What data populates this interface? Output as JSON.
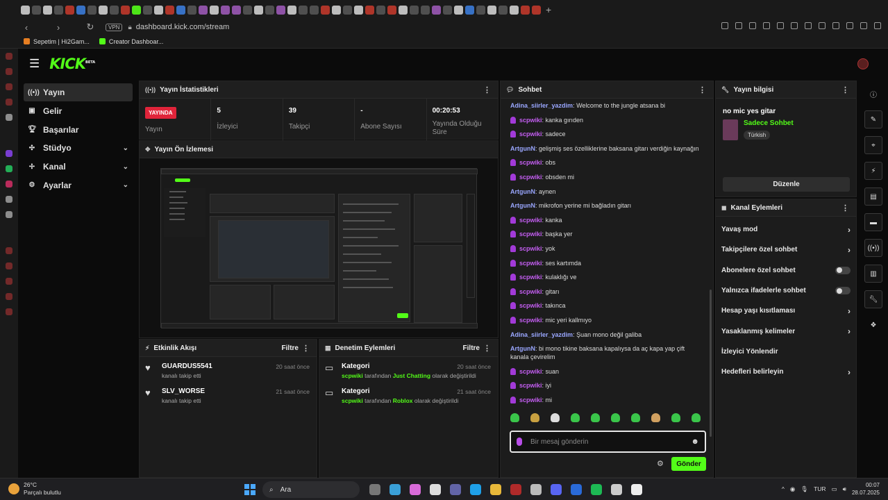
{
  "browser": {
    "url": "dashboard.kick.com/stream",
    "vpn_label": "VPN",
    "bookmarks": [
      "Sepetim | Hi2Gam...",
      "Creator Dashboar..."
    ]
  },
  "app": {
    "logo": "KICK",
    "logo_badge": "BETA",
    "nav": [
      {
        "label": "Yayın",
        "icon": "broadcast-icon",
        "active": true
      },
      {
        "label": "Gelir",
        "icon": "revenue-icon"
      },
      {
        "label": "Başarılar",
        "icon": "trophy-icon"
      },
      {
        "label": "Stüdyo",
        "icon": "studio-icon",
        "expandable": true
      },
      {
        "label": "Kanal",
        "icon": "channel-icon",
        "expandable": true
      },
      {
        "label": "Ayarlar",
        "icon": "gear-icon",
        "expandable": true
      }
    ]
  },
  "stats": {
    "title": "Yayın İstatistikleri",
    "live_badge": "YAYINDA",
    "items": [
      {
        "label": "Yayın"
      },
      {
        "value": "5",
        "label": "İzleyici"
      },
      {
        "value": "39",
        "label": "Takipçi"
      },
      {
        "value": "-",
        "label": "Abone Sayısı"
      },
      {
        "value": "00:20:53",
        "label": "Yayında Olduğu Süre"
      }
    ]
  },
  "preview": {
    "title": "Yayın Ön İzlemesi"
  },
  "activity": {
    "title": "Etkinlik Akışı",
    "filter": "Filtre",
    "items": [
      {
        "name": "GUARDUS5541",
        "sub": "kanalı takip etti",
        "time": "20 saat önce"
      },
      {
        "name": "SLV_WORSE",
        "sub": "kanalı takip etti",
        "time": "21 saat önce"
      }
    ]
  },
  "moderation": {
    "title": "Denetim Eylemleri",
    "filter": "Filtre",
    "items": [
      {
        "name": "Kategori",
        "user": "scpwiki",
        "mid": " tarafından ",
        "cat": "Just Chatting",
        "end": " olarak değiştirildi",
        "time": "20 saat önce"
      },
      {
        "name": "Kategori",
        "user": "scpwiki",
        "mid": " tarafından ",
        "cat": "Roblox",
        "end": " olarak değiştirildi",
        "time": "21 saat önce"
      }
    ]
  },
  "chat": {
    "title": "Sohbet",
    "messages": [
      {
        "user": "Adina_siirler_yazdim",
        "text": "Welcome to the jungle atsana bi",
        "sub": false
      },
      {
        "user": "scpwiki",
        "text": "kanka gırıden",
        "sub": true
      },
      {
        "user": "scpwiki",
        "text": "sadece",
        "sub": true
      },
      {
        "user": "ArtgunN",
        "text": "gelişmiş ses özelliklerine baksana gitarı verdiğin kaynağın",
        "sub": false
      },
      {
        "user": "scpwiki",
        "text": "obs",
        "sub": true
      },
      {
        "user": "scpwiki",
        "text": "obsden mi",
        "sub": true
      },
      {
        "user": "ArtgunN",
        "text": "aynen",
        "sub": false
      },
      {
        "user": "ArtgunN",
        "text": "mikrofon yerine mi bağladın gitarı",
        "sub": false
      },
      {
        "user": "scpwiki",
        "text": "kanka",
        "sub": true
      },
      {
        "user": "scpwiki",
        "text": "başka yer",
        "sub": true
      },
      {
        "user": "scpwiki",
        "text": "yok",
        "sub": true
      },
      {
        "user": "scpwiki",
        "text": "ses kartımda",
        "sub": true
      },
      {
        "user": "scpwiki",
        "text": "kulaklığı ve",
        "sub": true
      },
      {
        "user": "scpwiki",
        "text": "gitarı",
        "sub": true
      },
      {
        "user": "scpwiki",
        "text": "takınca",
        "sub": true
      },
      {
        "user": "scpwiki",
        "text": "mic yeri kallmıyo",
        "sub": true
      },
      {
        "user": "Adina_siirler_yazdim",
        "text": "Şuan mono değil galiba",
        "sub": false
      },
      {
        "user": "ArtgunN",
        "text": "bi mono tikine baksana kapalıysa da aç kapa yap çift kanala çevirelim",
        "sub": false
      },
      {
        "user": "scpwiki",
        "text": "suan",
        "sub": true
      },
      {
        "user": "scpwiki",
        "text": "iyi",
        "sub": true
      },
      {
        "user": "scpwiki",
        "text": "mi",
        "sub": true
      }
    ],
    "input_placeholder": "Bir mesaj gönderin",
    "send_label": "Gönder"
  },
  "info": {
    "title": "Yayın bilgisi",
    "stream_title": "no mic yes gitar",
    "category": "Sadece Sohbet",
    "language": "Türkish",
    "edit_label": "Düzenle"
  },
  "channel_actions": {
    "title": "Kanal Eylemleri",
    "items": [
      {
        "label": "Yavaş mod",
        "kind": "arrow"
      },
      {
        "label": "Takipçilere özel sohbet",
        "kind": "arrow"
      },
      {
        "label": "Abonelere özel sohbet",
        "kind": "toggle",
        "on": false
      },
      {
        "label": "Yalnızca ifadelerle sohbet",
        "kind": "toggle",
        "on": false
      },
      {
        "label": "Hesap yaşı kısıtlaması",
        "kind": "arrow"
      },
      {
        "label": "Yasaklanmış kelimeler",
        "kind": "arrow"
      },
      {
        "label": "İzleyici Yönlendir",
        "kind": "none"
      },
      {
        "label": "Hedefleri belirleyin",
        "kind": "arrow"
      }
    ]
  },
  "taskbar": {
    "temp": "26°C",
    "weather": "Parçalı bulutlu",
    "search": "Ara",
    "lang": "TUR",
    "time": "00:07",
    "date": "28.07.2025"
  }
}
